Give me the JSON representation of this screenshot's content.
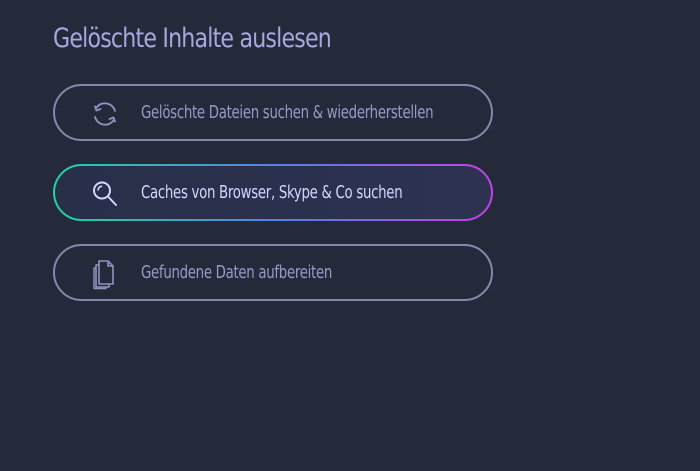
{
  "section": {
    "title": "Gelöschte Inhalte auslesen"
  },
  "options": [
    {
      "label": "Gelöschte Dateien suchen & wiederherstellen",
      "icon": "refresh-icon",
      "active": false
    },
    {
      "label": "Caches von Browser, Skype & Co suchen",
      "icon": "search-icon",
      "active": true
    },
    {
      "label": "Gefundene Daten aufbereiten",
      "icon": "documents-icon",
      "active": false
    }
  ],
  "colors": {
    "background": "#252a3a",
    "title": "#a6a8df",
    "border": "#8388ad",
    "label": "#979ac8",
    "active_label": "#d3d6ff",
    "active_gradient": [
      "#21d3a3",
      "#5b7be6",
      "#c441e6"
    ]
  }
}
